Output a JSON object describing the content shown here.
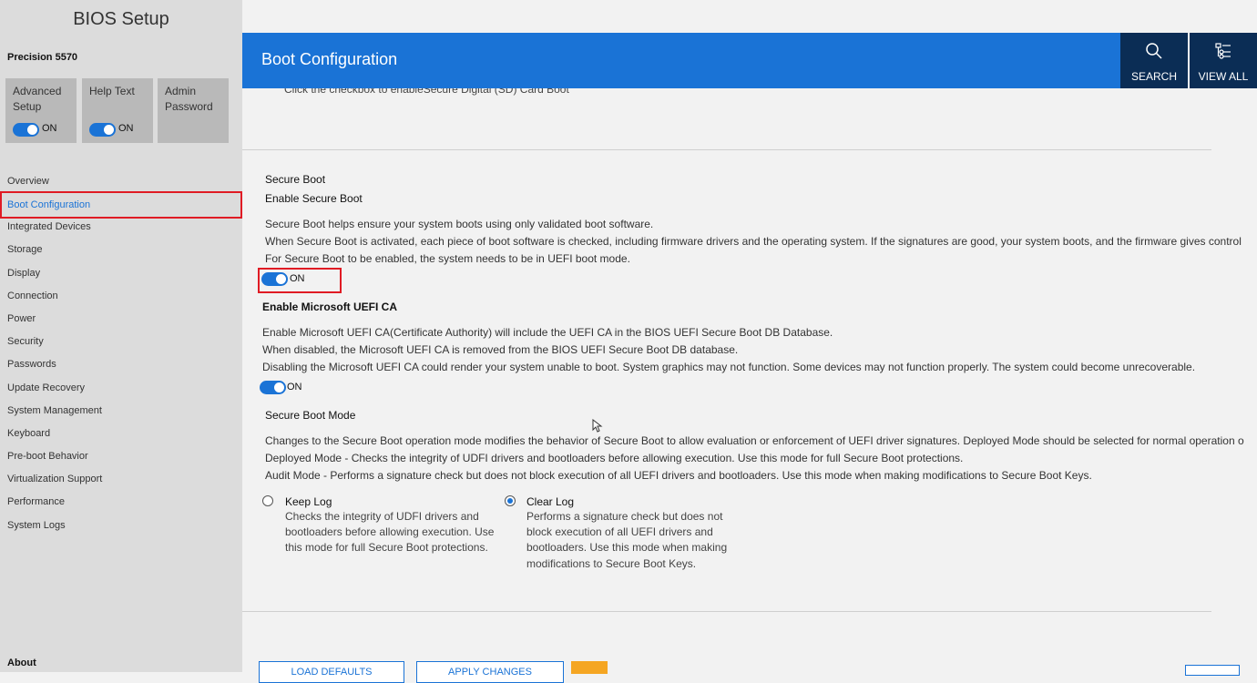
{
  "app": {
    "title": "BIOS Setup",
    "model": "Precision 5570"
  },
  "tiles": [
    {
      "label": "Advanced Setup",
      "toggle": "ON"
    },
    {
      "label": "Help Text",
      "toggle": "ON"
    },
    {
      "label": "Admin Password"
    }
  ],
  "nav": [
    {
      "label": "Overview"
    },
    {
      "label": "Boot Configuration",
      "active": true
    },
    {
      "label": "Integrated Devices"
    },
    {
      "label": "Storage"
    },
    {
      "label": "Display"
    },
    {
      "label": "Connection"
    },
    {
      "label": "Power"
    },
    {
      "label": "Security"
    },
    {
      "label": "Passwords"
    },
    {
      "label": "Update Recovery"
    },
    {
      "label": "System Management"
    },
    {
      "label": "Keyboard"
    },
    {
      "label": "Pre-boot Behavior"
    },
    {
      "label": "Virtualization Support"
    },
    {
      "label": "Performance"
    },
    {
      "label": "System Logs"
    }
  ],
  "about": "About",
  "header": {
    "title": "Boot Configuration",
    "search": "SEARCH",
    "view_all": "VIEW ALL"
  },
  "content": {
    "cut_text": "Click the checkbox to enableSecure Digital (SD) Card Boot",
    "secure_boot": {
      "section": "Secure Boot",
      "title": "Enable Secure Boot",
      "lines": [
        "Secure Boot helps ensure your system boots using only validated boot software.",
        "When Secure Boot is activated, each piece of boot software is checked, including firmware drivers and the operating system. If the signatures are good, your system boots, and the firmware gives control",
        "For Secure Boot to be enabled, the system needs to be in UEFI boot mode."
      ],
      "toggle": "ON"
    },
    "uefi_ca": {
      "title": "Enable Microsoft UEFI CA",
      "lines": [
        "Enable Microsoft UEFI CA(Certificate Authority) will include the UEFI CA in the BIOS UEFI Secure Boot DB Database.",
        "When disabled, the Microsoft UEFI CA is removed from the BIOS UEFI Secure Boot DB database.",
        "Disabling the Microsoft UEFI CA could render your system unable to boot. System graphics may not function. Some devices may not function properly. The system could become unrecoverable."
      ],
      "toggle": "ON"
    },
    "mode": {
      "title": "Secure Boot Mode",
      "lines": [
        "Changes to the Secure Boot operation mode modifies the behavior of Secure Boot to allow evaluation or enforcement of UEFI driver signatures. Deployed Mode should be selected for normal operation o",
        "Deployed Mode - Checks the integrity of UDFI drivers and bootloaders before allowing execution. Use this mode for full Secure Boot protections.",
        "Audit Mode - Performs a signature check but does not block execution of all UEFI drivers and bootloaders. Use this mode when making modifications to Secure Boot Keys."
      ],
      "options": [
        {
          "label": "Keep Log",
          "desc": "Checks the integrity of UDFI drivers and bootloaders before allowing execution. Use this mode for full Secure Boot protections.",
          "selected": false
        },
        {
          "label": "Clear Log",
          "desc": "Performs a signature check but does not block execution of all UEFI drivers and bootloaders. Use this mode when making modifications to Secure Boot Keys.",
          "selected": true
        }
      ]
    }
  },
  "footer": {
    "load_defaults": "LOAD DEFAULTS",
    "apply_changes": "APPLY CHANGES"
  }
}
